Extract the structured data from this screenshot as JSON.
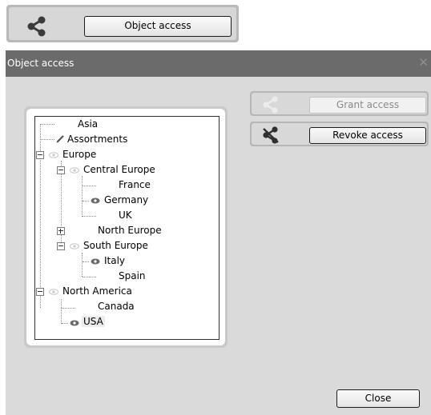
{
  "launcher": {
    "button_label": "Object access",
    "icon": "share-icon"
  },
  "dialog": {
    "title": "Object access",
    "close_glyph": "✕",
    "actions": {
      "grant_label": "Grant access",
      "revoke_label": "Revoke access"
    },
    "close_label": "Close",
    "tree": [
      {
        "label": "Asia"
      },
      {
        "label": "Assortments",
        "icon": "pencil-icon"
      },
      {
        "label": "Europe",
        "icon": "eye-icon",
        "expanded": true
      },
      {
        "label": "Central Europe",
        "icon": "eye-icon",
        "expanded": true
      },
      {
        "label": "France"
      },
      {
        "label": "Germany",
        "icon": "eye-icon"
      },
      {
        "label": "UK"
      },
      {
        "label": "North Europe",
        "expanded": false
      },
      {
        "label": "South Europe",
        "icon": "eye-icon",
        "expanded": true
      },
      {
        "label": "Italy",
        "icon": "eye-icon"
      },
      {
        "label": "Spain"
      },
      {
        "label": "North America",
        "icon": "eye-icon",
        "expanded": true
      },
      {
        "label": "Canada"
      },
      {
        "label": "USA",
        "icon": "eye-icon",
        "selected": true
      }
    ]
  },
  "colors": {
    "titlebar": "#6b6b6b",
    "dialog_bg": "#dadada",
    "panel_border": "#b6b6b6"
  }
}
